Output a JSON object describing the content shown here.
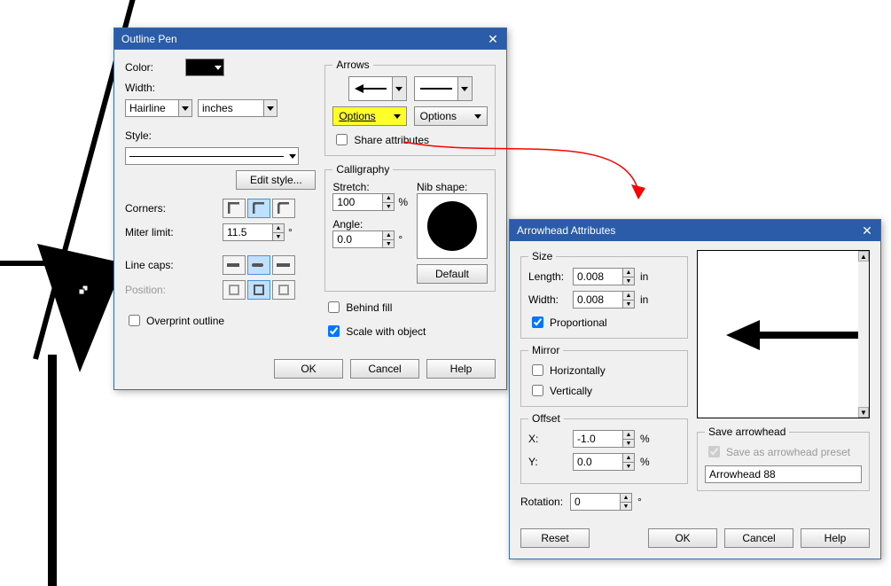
{
  "outline_pen": {
    "title": "Outline Pen",
    "color_label": "Color:",
    "width_label": "Width:",
    "width_value": "Hairline",
    "width_unit": "inches",
    "style_label": "Style:",
    "edit_style": "Edit style...",
    "corners_label": "Corners:",
    "miter_label": "Miter limit:",
    "miter_value": "11.5",
    "miter_unit": "°",
    "linecaps_label": "Line caps:",
    "position_label": "Position:",
    "overprint": "Overprint outline",
    "arrows_legend": "Arrows",
    "options_left": "Options",
    "options_right": "Options",
    "share_attr": "Share attributes",
    "calligraphy_legend": "Calligraphy",
    "stretch_label": "Stretch:",
    "stretch_value": "100",
    "stretch_unit": "%",
    "angle_label": "Angle:",
    "angle_value": "0.0",
    "angle_unit": "°",
    "nib_label": "Nib shape:",
    "default_btn": "Default",
    "behind_fill": "Behind fill",
    "scale_obj": "Scale with object",
    "ok": "OK",
    "cancel": "Cancel",
    "help": "Help"
  },
  "arrowhead": {
    "title": "Arrowhead Attributes",
    "size_legend": "Size",
    "length_label": "Length:",
    "length_value": "0.008",
    "length_unit": "in",
    "width_label": "Width:",
    "width_value": "0.008",
    "width_unit": "in",
    "proportional": "Proportional",
    "mirror_legend": "Mirror",
    "mirror_h": "Horizontally",
    "mirror_v": "Vertically",
    "offset_legend": "Offset",
    "x_label": "X:",
    "x_value": "-1.0",
    "x_unit": "%",
    "y_label": "Y:",
    "y_value": "0.0",
    "y_unit": "%",
    "rotation_label": "Rotation:",
    "rotation_value": "0",
    "rotation_unit": "°",
    "save_legend": "Save arrowhead",
    "save_preset": "Save as arrowhead preset",
    "preset_name": "Arrowhead 88",
    "reset": "Reset",
    "ok": "OK",
    "cancel": "Cancel",
    "help": "Help"
  }
}
